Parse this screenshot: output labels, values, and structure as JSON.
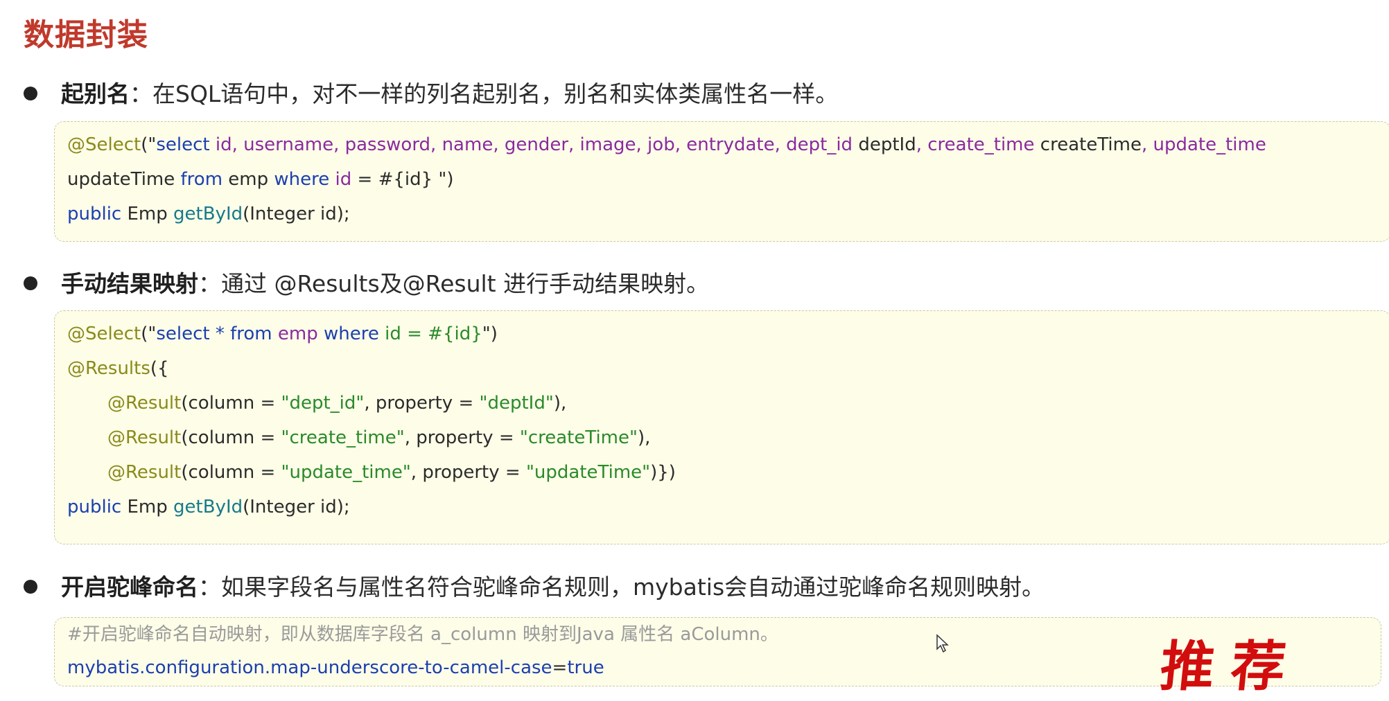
{
  "title": "数据封装",
  "sections": [
    {
      "heading": "起别名",
      "colon": "：",
      "desc": "在SQL语句中，对不一样的列名起别名，别名和实体类属性名一样。",
      "code": {
        "l1": {
          "anno": "@Select",
          "open": "(\"",
          "select": "select ",
          "cols": "id, username, password, name, gender, image, job, entrydate, dept_id",
          "alias1": " deptId",
          "sep1": ", ",
          "col2": "create_time",
          "alias2": " createTime",
          "sep2": ", ",
          "col3": "update_time"
        },
        "l2": {
          "alias3": "updateTime ",
          "from": "from",
          "table": " emp ",
          "where": "where",
          "col": " id",
          "rest": " = #{id} \")"
        },
        "l3": {
          "kw": "public",
          "type": " Emp ",
          "method": "getById",
          "params": "(Integer id);"
        }
      }
    },
    {
      "heading": "手动结果映射",
      "colon": "：",
      "desc": "通过 @Results及@Result 进行手动结果映射。",
      "code": {
        "l1": {
          "anno": "@Select",
          "open": "(\"",
          "q1": "select * ",
          "q2": "from",
          "q3": " emp ",
          "q4": "where",
          "q5": " id = #{id}",
          "close": "\")"
        },
        "l2": {
          "anno": "@Results",
          "open": "({"
        },
        "results": [
          {
            "anno": "@Result",
            "a": "(column = ",
            "col": "\"dept_id\"",
            "b": ", property = ",
            "prop": "\"deptId\"",
            "end": "),"
          },
          {
            "anno": "@Result",
            "a": "(column = ",
            "col": "\"create_time\"",
            "b": ", property = ",
            "prop": "\"createTime\"",
            "end": "),"
          },
          {
            "anno": "@Result",
            "a": "(column = ",
            "col": "\"update_time\"",
            "b": ", property = ",
            "prop": "\"updateTime\"",
            "end": ")})"
          }
        ],
        "last": {
          "kw": "public",
          "type": " Emp ",
          "method": "getById",
          "params": "(Integer id);"
        }
      }
    },
    {
      "heading": "开启驼峰命名",
      "colon": "：",
      "desc": "如果字段名与属性名符合驼峰命名规则，mybatis会自动通过驼峰命名规则映射。",
      "code": {
        "comment": "#开启驼峰命名自动映射，即从数据库字段名 a_column 映射到Java 属性名 aColumn。",
        "key": "mybatis.configuration.map-underscore-to-camel-case",
        "eq": "=",
        "value": "true"
      }
    }
  ],
  "stamp": "推荐",
  "colors": {
    "title": "#c0392b",
    "code_bg": "#fdfde8",
    "annotation": "#8a8a1a",
    "keyword": "#1b3fb0",
    "column": "#8a2aa0",
    "string": "#2a8a2a",
    "stamp": "#d20d0d"
  }
}
